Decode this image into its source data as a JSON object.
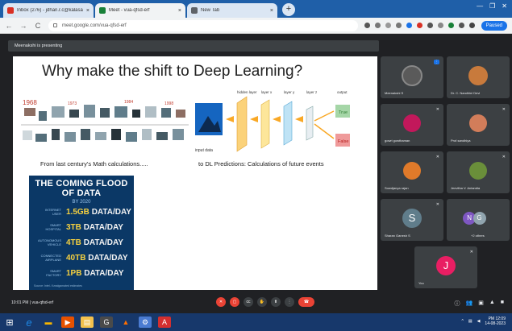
{
  "browser": {
    "tabs": [
      {
        "label": "Inbox (276) - jdhan.r.c@kalasa...",
        "icon_color": "#d93025",
        "active": false
      },
      {
        "label": "Meet - vua-qfsd-erf",
        "icon_color": "#188038",
        "active": true
      },
      {
        "label": "New Tab",
        "icon_color": "#5f6368",
        "active": false
      }
    ],
    "tab_close_glyph": "×",
    "new_tab_glyph": "+",
    "window_controls": [
      "—",
      "❐",
      "✕"
    ],
    "nav": {
      "back": "←",
      "forward": "→",
      "reload": "C"
    },
    "url": "meet.google.com/vua-qfsd-erf",
    "profile_label": "Paused"
  },
  "meet": {
    "presenter_label": "Meenakshi is presenting",
    "meeting_time": "10:01 PM",
    "meeting_code": "vua-qfsd-erf",
    "participants": [
      {
        "name": "Meenakshi S",
        "kind": "photo",
        "color": "#5a5a5a"
      },
      {
        "name": "Dr. C. Nandhini Devi",
        "kind": "photo",
        "color": "#c87a3c"
      },
      {
        "name": "gowri gowthaman",
        "kind": "photo",
        "color": "#c2185b"
      },
      {
        "name": "Prof.sandhiya",
        "kind": "photo",
        "color": "#d27d5a"
      },
      {
        "name": "Sowdjanya rajan",
        "kind": "photo",
        "color": "#e07a2a"
      },
      {
        "name": "Jeevitha V. Antandia",
        "kind": "photo",
        "color": "#6a8f3a"
      },
      {
        "name": "Sharan Ganesh S",
        "kind": "initial",
        "initial": "S",
        "color": "#607d8b"
      },
      {
        "name": "+2 others",
        "kind": "multi",
        "initial": "N",
        "initial2": "G",
        "color": "#7e57c2"
      },
      {
        "name": "You",
        "kind": "initial",
        "initial": "J",
        "color": "#e91e63"
      }
    ]
  },
  "slide": {
    "title": "Why make the shift to Deep Learning?",
    "timeline_years": [
      "1968",
      "1973",
      "1984",
      "1998"
    ],
    "left_caption": "From last century's Math calculations.....",
    "right_caption": "to DL Predictions: Calculations of  future events",
    "cnn": {
      "input_label": "input data",
      "layers": [
        "hidden layer",
        "layer x",
        "layer y",
        "layer z"
      ],
      "output_label": "output",
      "outputs": [
        "True",
        "False"
      ]
    },
    "flood": {
      "title": "THE COMING FLOOD OF DATA",
      "year": "BY 2020",
      "rows": [
        {
          "label": "INTERNET USER",
          "amount": "1.5GB",
          "unit": "DATA/DAY"
        },
        {
          "label": "SMART HOSPITAL",
          "amount": "3TB",
          "unit": "DATA/DAY"
        },
        {
          "label": "AUTONOMOUS VEHICLE",
          "amount": "4TB",
          "unit": "DATA/DAY"
        },
        {
          "label": "CONNECTED AIRPLANE",
          "amount": "40TB",
          "unit": "DATA/DAY"
        },
        {
          "label": "SMART FACTORY",
          "amount": "1PB",
          "unit": "DATA/DAY"
        }
      ],
      "footnote": "Source: Intel / Amalgamated estimates"
    }
  },
  "taskbar": {
    "apps": [
      {
        "name": "start",
        "glyph": "⊞",
        "color": "#17386b"
      },
      {
        "name": "edge",
        "glyph": "e",
        "color": "#1e88e5"
      },
      {
        "name": "explorer",
        "glyph": "▬",
        "color": "#f6b400"
      },
      {
        "name": "media",
        "glyph": "▶",
        "color": "#e65100"
      },
      {
        "name": "folder",
        "glyph": "▤",
        "color": "#f2c14e"
      },
      {
        "name": "chrome",
        "glyph": "G",
        "color": "#4a4a4a"
      },
      {
        "name": "vlc",
        "glyph": "▲",
        "color": "#ff6f00"
      },
      {
        "name": "settings",
        "glyph": "⚙",
        "color": "#4a7bd1"
      },
      {
        "name": "acrobat",
        "glyph": "A",
        "color": "#d32f2f"
      }
    ],
    "clock_time": "PM 12:09",
    "clock_date": "14-08-2023"
  }
}
